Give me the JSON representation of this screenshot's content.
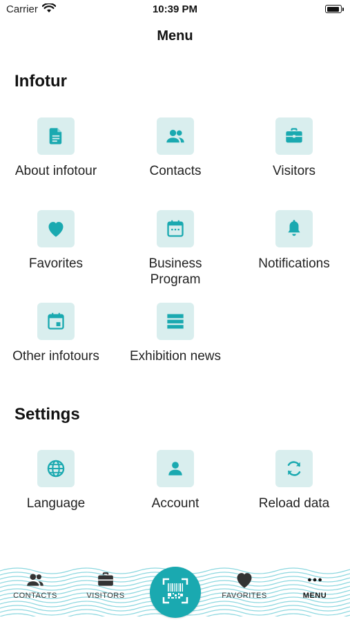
{
  "status_bar": {
    "carrier": "Carrier",
    "time": "10:39 PM"
  },
  "nav": {
    "title": "Menu"
  },
  "sections": [
    {
      "title": "Infotur",
      "items": [
        {
          "label": "About infotour",
          "icon": "document-icon"
        },
        {
          "label": "Contacts",
          "icon": "people-icon"
        },
        {
          "label": "Visitors",
          "icon": "briefcase-icon"
        },
        {
          "label": "Favorites",
          "icon": "heart-icon"
        },
        {
          "label": "Business Program",
          "icon": "calendar-icon"
        },
        {
          "label": "Notifications",
          "icon": "bell-icon"
        },
        {
          "label": "Other infotours",
          "icon": "calendar-event-icon"
        },
        {
          "label": "Exhibition news",
          "icon": "news-icon"
        }
      ]
    },
    {
      "title": "Settings",
      "items": [
        {
          "label": "Language",
          "icon": "globe-icon"
        },
        {
          "label": "Account",
          "icon": "person-icon"
        },
        {
          "label": "Reload data",
          "icon": "reload-icon"
        }
      ]
    }
  ],
  "tab_bar": {
    "items": [
      {
        "label": "CONTACTS",
        "icon": "people-icon"
      },
      {
        "label": "VISITORS",
        "icon": "briefcase-icon"
      },
      {
        "label": "FAVORITES",
        "icon": "heart-icon"
      },
      {
        "label": "MENU",
        "icon": "more-icon",
        "active": true
      }
    ],
    "center_button_icon": "barcode-scan-icon"
  },
  "colors": {
    "accent": "#1aa9b0",
    "tile_background": "#d9eeee",
    "wave": "#7fd3dc",
    "text": "#222222"
  }
}
